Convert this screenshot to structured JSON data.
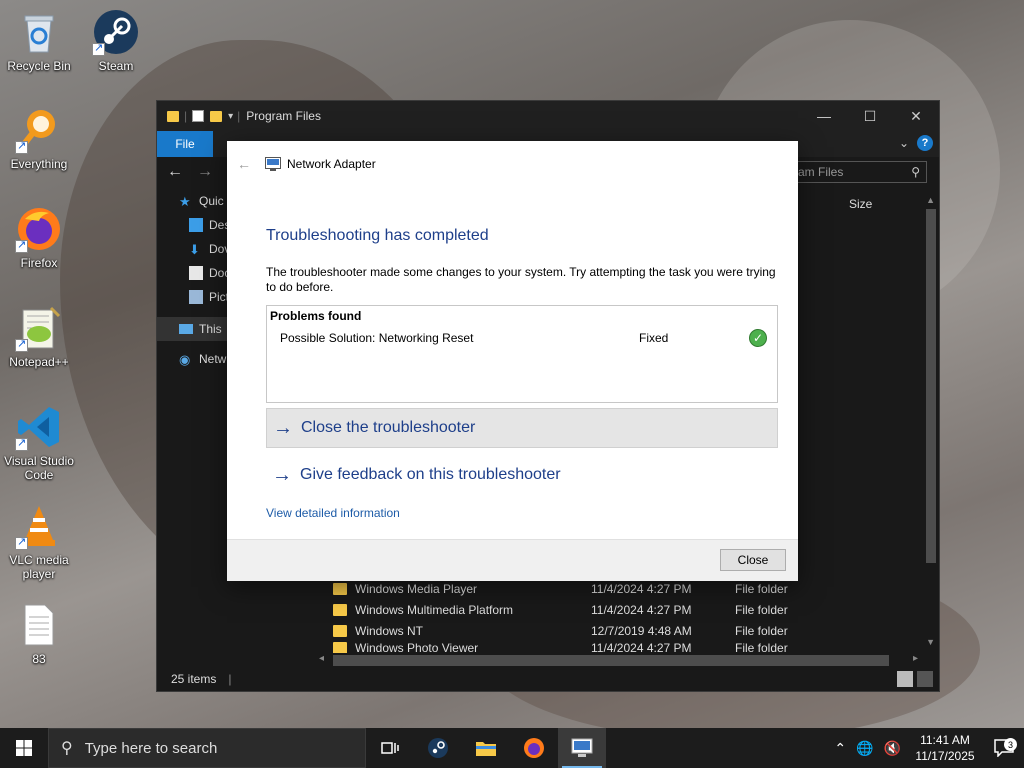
{
  "desktop": {
    "icons": [
      {
        "label": "Recycle Bin",
        "icon": "recycle-bin-icon"
      },
      {
        "label": "Steam",
        "icon": "steam-icon"
      },
      {
        "label": "Everything",
        "icon": "everything-icon"
      },
      {
        "label": "Firefox",
        "icon": "firefox-icon"
      },
      {
        "label": "Notepad++",
        "icon": "notepad-plus-plus-icon"
      },
      {
        "label": "Visual Studio Code",
        "icon": "vscode-icon"
      },
      {
        "label": "VLC media player",
        "icon": "vlc-icon"
      },
      {
        "label": "83",
        "icon": "text-file-icon"
      }
    ]
  },
  "explorer": {
    "title": "Program Files",
    "file_tab": "File",
    "search_placeholder": "Search Program Files",
    "search_visible": "ram Files",
    "column_size": "Size",
    "sidebar": [
      "Quic",
      "Des",
      "Dov",
      "Doc",
      "Pict",
      "This",
      "Netw"
    ],
    "rows": [
      {
        "name": "Windows Media Player",
        "date": "11/4/2024 4:27 PM",
        "type": "File folder"
      },
      {
        "name": "Windows Multimedia Platform",
        "date": "11/4/2024 4:27 PM",
        "type": "File folder"
      },
      {
        "name": "Windows NT",
        "date": "12/7/2019 4:48 AM",
        "type": "File folder"
      },
      {
        "name": "Windows Photo Viewer",
        "date": "11/4/2024 4:27 PM",
        "type": "File folder"
      }
    ],
    "status": "25 items"
  },
  "dialog": {
    "title": "Network Adapter",
    "heading": "Troubleshooting has completed",
    "message": "The troubleshooter made some changes to your system. Try attempting the task you were trying to do before.",
    "problems_title": "Problems found",
    "problem": {
      "name": "Possible Solution: Networking Reset",
      "status": "Fixed"
    },
    "close_action": "Close the troubleshooter",
    "feedback_action": "Give feedback on this troubleshooter",
    "detail_link": "View detailed information",
    "close_button": "Close"
  },
  "taskbar": {
    "search_placeholder": "Type here to search",
    "time": "11:41 AM",
    "date": "11/17/2025",
    "notification_count": "3"
  },
  "colors": {
    "accent": "#1979ca",
    "dialog_heading": "#1e3f8a",
    "link": "#1e5ca8"
  }
}
